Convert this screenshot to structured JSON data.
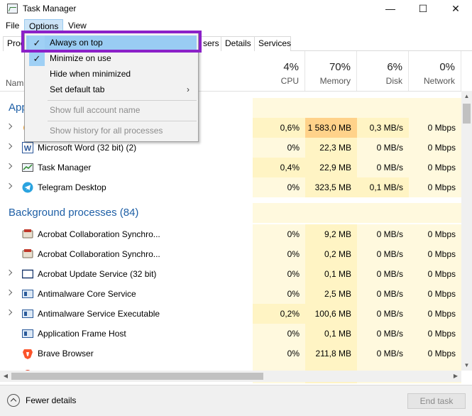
{
  "window": {
    "title": "Task Manager",
    "minimize_glyph": "—",
    "maximize_glyph": "☐",
    "close_glyph": "✕"
  },
  "menu": [
    "File",
    "Options",
    "View"
  ],
  "tabs": [
    "Proc",
    "sers",
    "Details",
    "Services"
  ],
  "columns": {
    "name_label": "Nam",
    "cpu": {
      "pct": "4%",
      "label": "CPU"
    },
    "memory": {
      "pct": "70%",
      "label": "Memory"
    },
    "disk": {
      "pct": "6%",
      "label": "Disk"
    },
    "network": {
      "pct": "0%",
      "label": "Network"
    }
  },
  "groups": {
    "apps_title": "App",
    "background_title": "Background processes (84)"
  },
  "apps": [
    {
      "name": "",
      "cpu": "0,6%",
      "memory": "1 583,0 MB",
      "disk": "0,3 MB/s",
      "network": "0 Mbps"
    },
    {
      "name": "Microsoft Word (32 bit) (2)",
      "cpu": "0%",
      "memory": "22,3 MB",
      "disk": "0 MB/s",
      "network": "0 Mbps"
    },
    {
      "name": "Task Manager",
      "cpu": "0,4%",
      "memory": "22,9 MB",
      "disk": "0 MB/s",
      "network": "0 Mbps"
    },
    {
      "name": "Telegram Desktop",
      "cpu": "0%",
      "memory": "323,5 MB",
      "disk": "0,1 MB/s",
      "network": "0 Mbps"
    }
  ],
  "background": [
    {
      "name": "Acrobat Collaboration Synchro...",
      "cpu": "0%",
      "memory": "9,2 MB",
      "disk": "0 MB/s",
      "network": "0 Mbps"
    },
    {
      "name": "Acrobat Collaboration Synchro...",
      "cpu": "0%",
      "memory": "0,2 MB",
      "disk": "0 MB/s",
      "network": "0 Mbps"
    },
    {
      "name": "Acrobat Update Service (32 bit)",
      "cpu": "0%",
      "memory": "0,1 MB",
      "disk": "0 MB/s",
      "network": "0 Mbps"
    },
    {
      "name": "Antimalware Core Service",
      "cpu": "0%",
      "memory": "2,5 MB",
      "disk": "0 MB/s",
      "network": "0 Mbps"
    },
    {
      "name": "Antimalware Service Executable",
      "cpu": "0,2%",
      "memory": "100,6 MB",
      "disk": "0 MB/s",
      "network": "0 Mbps"
    },
    {
      "name": "Application Frame Host",
      "cpu": "0%",
      "memory": "0,1 MB",
      "disk": "0 MB/s",
      "network": "0 Mbps"
    },
    {
      "name": "Brave Browser",
      "cpu": "0%",
      "memory": "211,8 MB",
      "disk": "0 MB/s",
      "network": "0 Mbps"
    }
  ],
  "options_menu": {
    "items": [
      {
        "label": "Always on top",
        "checked": true
      },
      {
        "label": "Minimize on use",
        "checked": true
      },
      {
        "label": "Hide when minimized",
        "checked": false
      },
      {
        "label": "Set default tab",
        "checked": false
      },
      {
        "label": "Show full account name",
        "checked": false
      },
      {
        "label": "Show history for all processes",
        "checked": false
      }
    ],
    "check_glyph": "✓",
    "submenu_glyph": "›"
  },
  "footer": {
    "fewer_details": "Fewer details",
    "end_task": "End task"
  },
  "colors": {
    "highlight_border": "#8b21c8",
    "group_title": "#1e5fa6",
    "heat_high": "#ffd28a",
    "heat_low": "#fff4c4"
  }
}
